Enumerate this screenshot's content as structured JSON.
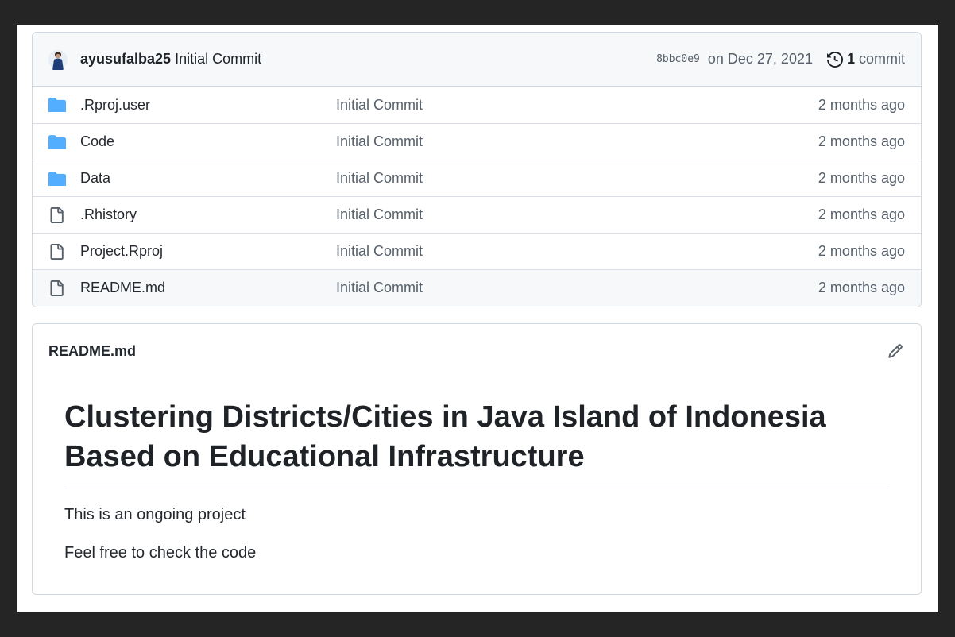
{
  "commit": {
    "author": "ayusufalba25",
    "message": "Initial Commit",
    "sha": "8bbc0e9",
    "date": "on Dec 27, 2021",
    "count": "1",
    "count_label": "commit"
  },
  "files": [
    {
      "type": "folder",
      "icon": "folder-icon",
      "name": ".Rproj.user",
      "message": "Initial Commit",
      "age": "2 months ago"
    },
    {
      "type": "folder",
      "icon": "folder-icon",
      "name": "Code",
      "message": "Initial Commit",
      "age": "2 months ago"
    },
    {
      "type": "folder",
      "icon": "folder-icon",
      "name": "Data",
      "message": "Initial Commit",
      "age": "2 months ago"
    },
    {
      "type": "file",
      "icon": "file-icon",
      "name": ".Rhistory",
      "message": "Initial Commit",
      "age": "2 months ago"
    },
    {
      "type": "file",
      "icon": "file-icon",
      "name": "Project.Rproj",
      "message": "Initial Commit",
      "age": "2 months ago"
    },
    {
      "type": "file",
      "icon": "file-icon",
      "name": "README.md",
      "message": "Initial Commit",
      "age": "2 months ago"
    }
  ],
  "readme": {
    "filename": "README.md",
    "edit_icon": "pencil-icon",
    "title": "Clustering Districts/Cities in Java Island of Indonesia Based on Educational Infrastructure",
    "paragraphs": [
      "This is an ongoing project",
      "Feel free to check the code"
    ]
  },
  "colors": {
    "folder": "#54aeff",
    "file_icon": "#57606a",
    "border": "#d0d7de",
    "header_bg": "#f6f8fa",
    "outer_bg": "#252525"
  }
}
